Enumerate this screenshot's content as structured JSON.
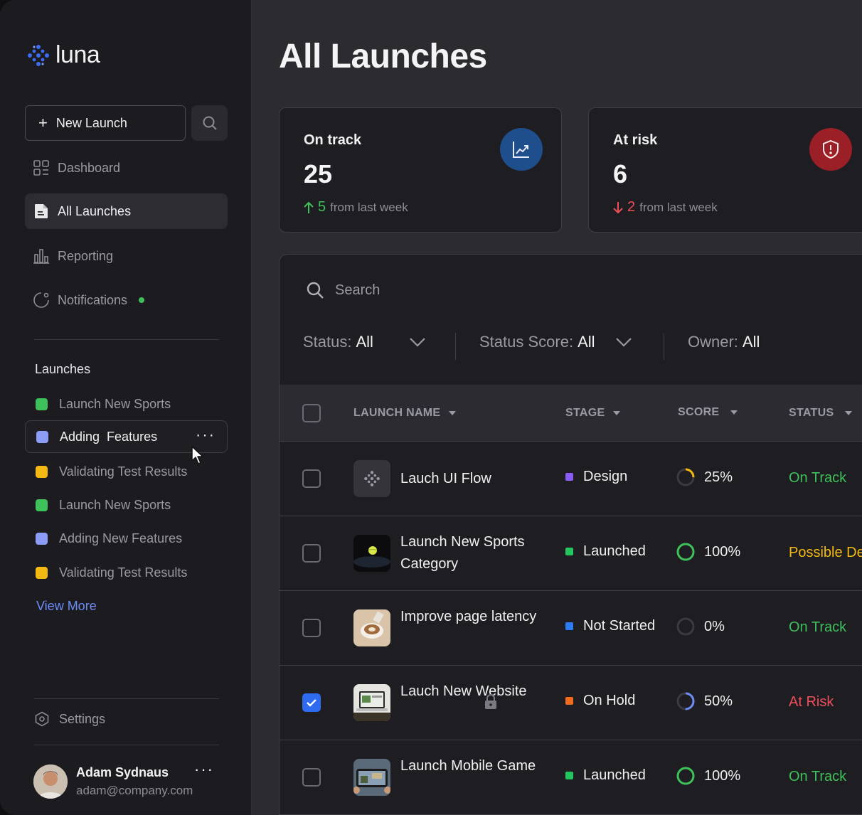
{
  "app": {
    "name": "luna"
  },
  "sidebar": {
    "new_launch_label": "New Launch",
    "nav": [
      {
        "label": "Dashboard",
        "icon": "dashboard-icon",
        "active": false
      },
      {
        "label": "All Launches",
        "icon": "document-icon",
        "active": true
      },
      {
        "label": "Reporting",
        "icon": "bar-chart-icon",
        "active": false
      },
      {
        "label": "Notifications",
        "icon": "bell-icon",
        "active": false
      }
    ],
    "launches_title": "Launches",
    "launches": [
      {
        "label": "Launch New Sports",
        "color": "#3ec05a"
      },
      {
        "label": "Adding  Features",
        "color": "#8b9df7"
      },
      {
        "label": "Validating Test Results",
        "color": "#f5b913"
      },
      {
        "label": "Launch New Sports",
        "color": "#3ec05a"
      },
      {
        "label": "Adding New Features",
        "color": "#8b9df7"
      },
      {
        "label": "Validating Test Results",
        "color": "#f5b913"
      }
    ],
    "view_more": "View More",
    "settings_label": "Settings",
    "user": {
      "name": "Adam Sydnaus",
      "email": "adam@company.com"
    }
  },
  "main": {
    "title": "All Launches",
    "stats": [
      {
        "label": "On track",
        "value": "25",
        "delta": "5",
        "delta_text": "from last week",
        "direction": "up",
        "color": "#3ec05a",
        "badge_color": "#1e4f8c"
      },
      {
        "label": "At risk",
        "value": "6",
        "delta": "2",
        "delta_text": "from last week",
        "direction": "down",
        "color": "#ef4d5a",
        "badge_color": "#9a1f27"
      }
    ],
    "search_placeholder": "Search",
    "filters": {
      "status_label": "Status:",
      "status_value": "All",
      "score_label": "Status Score:",
      "score_value": "All",
      "owner_label": "Owner:",
      "owner_value": "All"
    },
    "columns": {
      "name": "LAUNCH NAME",
      "stage": "STAGE",
      "score": "SCORE",
      "status": "STATUS"
    },
    "rows": [
      {
        "name": "Lauch UI Flow",
        "stage": "Design",
        "stage_color": "#8a5cf6",
        "score": "25%",
        "score_pct": 25,
        "score_color": "#f5b913",
        "status": "On Track",
        "status_color": "#3ec05a",
        "checked": false,
        "locked": false,
        "thumb": "luna-logo"
      },
      {
        "name": "Launch New Sports Category",
        "stage": "Launched",
        "stage_color": "#22c55e",
        "score": "100%",
        "score_pct": 100,
        "score_color": "#3ec05a",
        "status": "Possible De",
        "status_color": "#f5b913",
        "checked": false,
        "locked": false,
        "thumb": "tennis-ball"
      },
      {
        "name": "Improve page latency",
        "stage": "Not Started",
        "stage_color": "#2f7bf5",
        "score": "0%",
        "score_pct": 0,
        "score_color": "#6a6a72",
        "status": "On Track",
        "status_color": "#3ec05a",
        "checked": false,
        "locked": false,
        "thumb": "coffee-cup"
      },
      {
        "name": "Lauch New Website",
        "stage": "On Hold",
        "stage_color": "#f26b1d",
        "score": "50%",
        "score_pct": 50,
        "score_color": "#6d8cf5",
        "status": "At Risk",
        "status_color": "#ef4d5a",
        "checked": true,
        "locked": true,
        "thumb": "laptop"
      },
      {
        "name": "Launch Mobile Game",
        "stage": "Launched",
        "stage_color": "#22c55e",
        "score": "100%",
        "score_pct": 100,
        "score_color": "#3ec05a",
        "status": "On Track",
        "status_color": "#3ec05a",
        "checked": false,
        "locked": false,
        "thumb": "phone-game"
      }
    ]
  }
}
